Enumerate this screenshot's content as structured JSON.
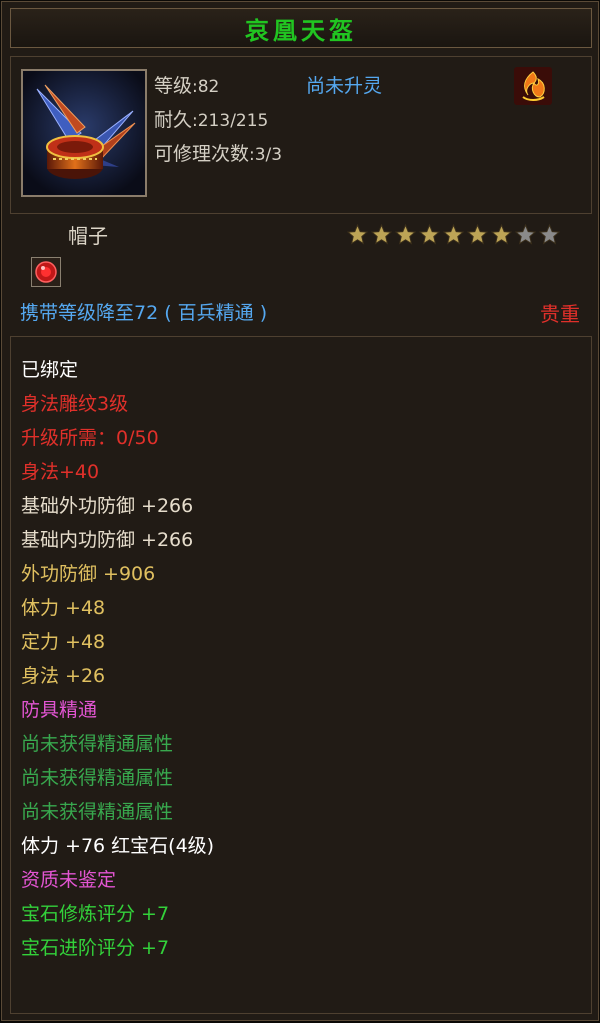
{
  "item": {
    "name": "哀凰天盔",
    "level_label": "等级",
    "level_value": ":82",
    "spirit_status": "尚未升灵",
    "durability_label": "耐久",
    "durability_value": ":213/215",
    "repair_label": "可修理次数",
    "repair_value": ":3/3",
    "type": "帽子",
    "stars_filled": 7,
    "stars_total": 9,
    "requirement": "携带等级降至72 ( 百兵精通 )",
    "rarity": "贵重",
    "icon": "helmet-icon",
    "rune_icon": "flame-rune-icon",
    "gem_icon": "red-gem-icon"
  },
  "colors": {
    "title": "#21c521",
    "blue": "#55a8f0",
    "red": "#e0302a",
    "white": "#ffffff",
    "beige": "#e6ddcc",
    "gold": "#e0c060",
    "pink": "#e255d2",
    "green": "#38a84e",
    "bright_green": "#33d13a",
    "star_gold": "#bda456",
    "star_gray": "#8a8a8a"
  },
  "attributes": [
    {
      "text": "已绑定",
      "color": "#ffffff"
    },
    {
      "text": "身法雕纹3级",
      "color": "#e0302a"
    },
    {
      "text": "升级所需：0/50",
      "color": "#e0302a"
    },
    {
      "text": "身法+40",
      "color": "#e0302a"
    },
    {
      "text": "基础外功防御 +266",
      "color": "#e6ddcc"
    },
    {
      "text": "基础内功防御 +266",
      "color": "#e6ddcc"
    },
    {
      "text": "外功防御 +906",
      "color": "#e0c060"
    },
    {
      "text": "体力 +48",
      "color": "#e0c060"
    },
    {
      "text": "定力 +48",
      "color": "#e0c060"
    },
    {
      "text": "身法 +26",
      "color": "#e0c060"
    },
    {
      "text": "防具精通",
      "color": "#e255d2"
    },
    {
      "text": "尚未获得精通属性",
      "color": "#38a84e"
    },
    {
      "text": "尚未获得精通属性",
      "color": "#38a84e"
    },
    {
      "text": "尚未获得精通属性",
      "color": "#38a84e"
    },
    {
      "text": "体力 +76 红宝石(4级)",
      "color": "#ffffff"
    },
    {
      "text": "资质未鉴定",
      "color": "#e255d2"
    },
    {
      "text": "宝石修炼评分 +7",
      "color": "#33d13a"
    },
    {
      "text": "宝石进阶评分 +7",
      "color": "#33d13a"
    }
  ]
}
